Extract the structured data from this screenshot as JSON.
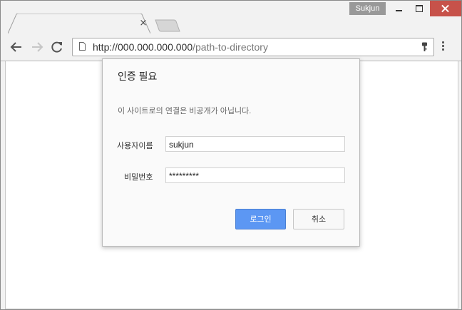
{
  "titlebar": {
    "profile_name": "Sukjun",
    "tab_close": "×"
  },
  "toolbar": {
    "url_host": "http://000.000.000.000",
    "url_path": "/path-to-directory"
  },
  "dialog": {
    "title": "인증 필요",
    "message": "이 사이트로의 연결은 비공개가 아닙니다.",
    "username_label": "사용자이름",
    "username_value": "sukjun",
    "password_label": "비밀번호",
    "password_value": "*********",
    "login_label": "로그인",
    "cancel_label": "취소"
  },
  "colors": {
    "close_button": "#c7524a",
    "login_button": "#5c97f3",
    "profile_badge": "#999999"
  },
  "icons": [
    "back-icon",
    "forward-icon",
    "reload-icon",
    "page-icon",
    "key-icon",
    "menu-icon",
    "close-icon",
    "minimize-icon",
    "maximize-icon"
  ]
}
